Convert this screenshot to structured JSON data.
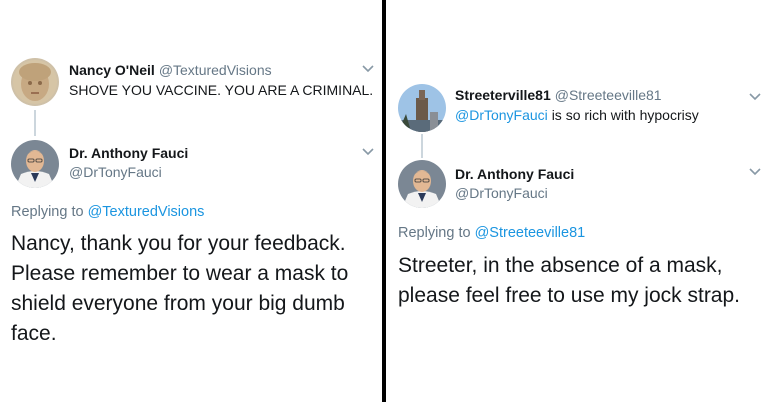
{
  "left": {
    "tweet1": {
      "name": "Nancy O'Neil",
      "handle": "@TexturedVisions",
      "text": "SHOVE YOU VACCINE. YOU ARE A CRIMINAL."
    },
    "tweet2": {
      "name": "Dr. Anthony Fauci",
      "handle": "@DrTonyFauci",
      "replying_prefix": "Replying to",
      "replying_to": "@TexturedVisions",
      "body_lines": [
        "Nancy, thank you for your feedback.",
        "Please remember to wear a mask to",
        "shield everyone from your big dumb",
        "face."
      ]
    }
  },
  "right": {
    "tweet1": {
      "name": "Streeterville81",
      "handle": "@Streeteeville81",
      "mention": "@DrTonyFauci",
      "text": "is so rich with hypocrisy"
    },
    "tweet2": {
      "name": "Dr. Anthony Fauci",
      "handle": "@DrTonyFauci",
      "replying_prefix": "Replying to",
      "replying_to": "@Streeteeville81",
      "body_lines": [
        "Streeter, in the absence of a mask,",
        "please feel free to use my jock strap."
      ]
    }
  },
  "icons": {
    "chevron": "chevron-down-icon"
  }
}
